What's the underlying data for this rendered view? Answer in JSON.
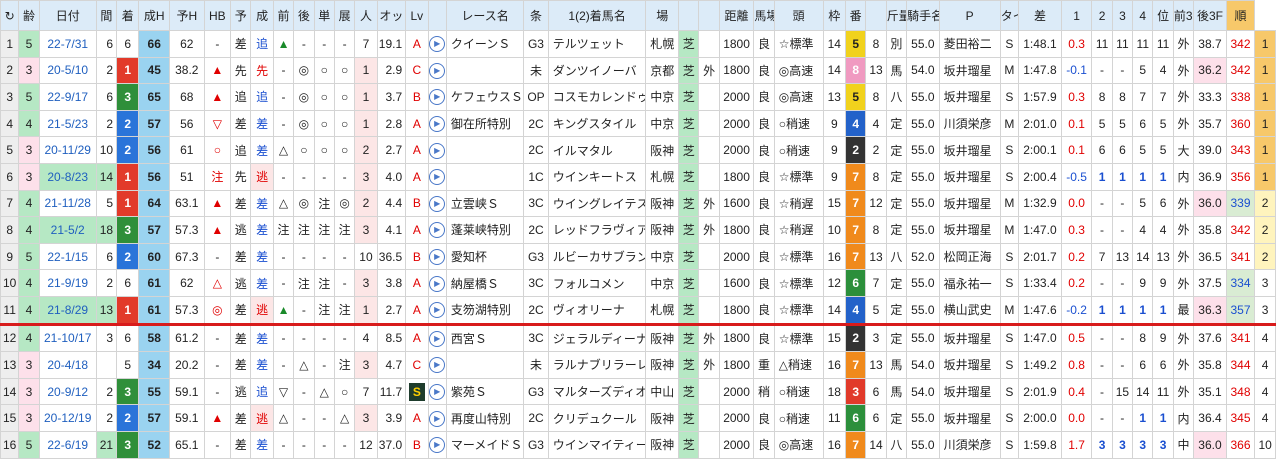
{
  "headers": [
    "↻",
    "齢",
    "日付",
    "間",
    "着",
    "成H",
    "予H",
    "HB",
    "予",
    "成",
    "前",
    "後",
    "単",
    "展",
    "人",
    "オッ",
    "Lv",
    "",
    "レース名",
    "条",
    "1(2)着馬名",
    "場",
    "",
    "",
    "距離",
    "馬場lv",
    "頭",
    "枠",
    "番",
    "",
    "斤量",
    "騎手名",
    "P",
    "タイム",
    "差",
    "1",
    "2",
    "3",
    "4",
    "位",
    "前3F",
    "後3F",
    "順"
  ],
  "rows": [
    [
      "1",
      "5",
      "22-7/31",
      "6",
      "6",
      "66",
      "62",
      "-",
      "差",
      "追",
      "▲",
      "-",
      "-",
      "-",
      "7",
      "19.1",
      "A",
      "▸",
      "クイーンＳ",
      "G3",
      "テルツェット",
      "札幌",
      "芝",
      "",
      "1800",
      "良",
      "☆標準",
      "14",
      "5",
      "8",
      "別",
      "55.0",
      "菱田裕二",
      "S",
      "1:48.1",
      "0.3",
      "11",
      "11",
      "11",
      "11",
      "外",
      "38.7",
      "342",
      "1"
    ],
    [
      "2",
      "3",
      "20-5/10",
      "2",
      "1",
      "45",
      "38.2",
      "▲",
      "先",
      "先",
      "-",
      "◎",
      "○",
      "○",
      "1",
      "2.9",
      "C",
      "▸",
      "",
      "未",
      "ダンツイノーバ",
      "京都",
      "芝",
      "外",
      "1800",
      "良",
      "◎高速",
      "14",
      "8",
      "13",
      "馬",
      "54.0",
      "坂井瑠星",
      "M",
      "1:47.8",
      "-0.1",
      "-",
      "-",
      "5",
      "4",
      "外",
      "36.2",
      "342",
      "1"
    ],
    [
      "3",
      "5",
      "22-9/17",
      "6",
      "3",
      "65",
      "68",
      "▲",
      "追",
      "追",
      "-",
      "◎",
      "○",
      "○",
      "1",
      "3.7",
      "B",
      "▸",
      "ケフェウスＳ",
      "OP",
      "コスモカレンドゥラ",
      "中京",
      "芝",
      "",
      "2000",
      "良",
      "◎高速",
      "13",
      "5",
      "8",
      "八",
      "55.0",
      "坂井瑠星",
      "S",
      "1:57.9",
      "0.3",
      "8",
      "8",
      "7",
      "7",
      "外",
      "33.3",
      "338",
      "1"
    ],
    [
      "4",
      "4",
      "21-5/23",
      "2",
      "2",
      "57",
      "56",
      "▽",
      "差",
      "差",
      "-",
      "◎",
      "○",
      "○",
      "1",
      "2.8",
      "A",
      "▸",
      "御在所特別",
      "2C",
      "キングスタイル",
      "中京",
      "芝",
      "",
      "2000",
      "良",
      "○稍速",
      "9",
      "4",
      "4",
      "定",
      "55.0",
      "川須栄彦",
      "M",
      "2:01.0",
      "0.1",
      "5",
      "5",
      "6",
      "5",
      "外",
      "35.7",
      "360",
      "1"
    ],
    [
      "5",
      "3",
      "20-11/29",
      "10",
      "2",
      "56",
      "61",
      "○",
      "追",
      "差",
      "△",
      "○",
      "○",
      "○",
      "2",
      "2.7",
      "A",
      "▸",
      "",
      "2C",
      "イルマタル",
      "阪神",
      "芝",
      "",
      "2000",
      "良",
      "○稍速",
      "9",
      "2",
      "2",
      "定",
      "55.0",
      "坂井瑠星",
      "S",
      "2:00.1",
      "0.1",
      "6",
      "6",
      "5",
      "5",
      "大",
      "39.0",
      "343",
      "1"
    ],
    [
      "6",
      "3",
      "20-8/23",
      "14",
      "1",
      "56",
      "51",
      "注",
      "先",
      "逃",
      "-",
      "-",
      "-",
      "-",
      "3",
      "4.0",
      "A",
      "▸",
      "",
      "1C",
      "ウインキートス",
      "札幌",
      "芝",
      "",
      "1800",
      "良",
      "☆標準",
      "9",
      "7",
      "8",
      "定",
      "55.0",
      "坂井瑠星",
      "S",
      "2:00.4",
      "-0.5",
      "1",
      "1",
      "1",
      "1",
      "内",
      "36.9",
      "356",
      "1"
    ],
    [
      "7",
      "4",
      "21-11/28",
      "5",
      "1",
      "64",
      "63.1",
      "▲",
      "差",
      "差",
      "△",
      "◎",
      "注",
      "◎",
      "2",
      "4.4",
      "B",
      "▸",
      "立雲峡Ｓ",
      "3C",
      "ウイングレイテスト",
      "阪神",
      "芝",
      "外",
      "1600",
      "良",
      "☆稍遅",
      "15",
      "7",
      "12",
      "定",
      "55.0",
      "坂井瑠星",
      "M",
      "1:32.9",
      "0.0",
      "-",
      "-",
      "5",
      "6",
      "外",
      "36.0",
      "339",
      "2"
    ],
    [
      "8",
      "4",
      "21-5/2",
      "18",
      "3",
      "57",
      "57.3",
      "▲",
      "逃",
      "差",
      "注",
      "注",
      "注",
      "注",
      "3",
      "4.1",
      "A",
      "▸",
      "蓬莱峡特別",
      "2C",
      "レッドフラヴィア",
      "阪神",
      "芝",
      "外",
      "1800",
      "良",
      "☆稍遅",
      "10",
      "7",
      "8",
      "定",
      "55.0",
      "坂井瑠星",
      "M",
      "1:47.0",
      "0.3",
      "-",
      "-",
      "4",
      "4",
      "外",
      "35.8",
      "342",
      "2"
    ],
    [
      "9",
      "5",
      "22-1/15",
      "6",
      "2",
      "60",
      "67.3",
      "-",
      "差",
      "差",
      "-",
      "-",
      "-",
      "-",
      "10",
      "36.5",
      "B",
      "▸",
      "愛知杯",
      "G3",
      "ルビーカサブランカ",
      "中京",
      "芝",
      "",
      "2000",
      "良",
      "☆標準",
      "16",
      "7",
      "13",
      "八",
      "52.0",
      "松岡正海",
      "S",
      "2:01.7",
      "0.2",
      "7",
      "13",
      "14",
      "13",
      "外",
      "36.5",
      "341",
      "2"
    ],
    [
      "10",
      "4",
      "21-9/19",
      "2",
      "6",
      "61",
      "62",
      "△",
      "逃",
      "差",
      "-",
      "注",
      "注",
      "-",
      "3",
      "3.8",
      "A",
      "▸",
      "納屋橋Ｓ",
      "3C",
      "フォルコメン",
      "中京",
      "芝",
      "",
      "1600",
      "良",
      "☆標準",
      "12",
      "6",
      "7",
      "定",
      "55.0",
      "福永祐一",
      "S",
      "1:33.4",
      "0.2",
      "-",
      "-",
      "9",
      "9",
      "外",
      "37.5",
      "334",
      "3"
    ],
    [
      "11",
      "4",
      "21-8/29",
      "13",
      "1",
      "61",
      "57.3",
      "◎",
      "差",
      "逃",
      "▲",
      "-",
      "注",
      "注",
      "1",
      "2.7",
      "A",
      "▸",
      "支笏湖特別",
      "2C",
      "ヴィオリーナ",
      "札幌",
      "芝",
      "",
      "1800",
      "良",
      "☆標準",
      "14",
      "4",
      "5",
      "定",
      "55.0",
      "横山武史",
      "M",
      "1:47.6",
      "-0.2",
      "1",
      "1",
      "1",
      "1",
      "最",
      "36.3",
      "357",
      "3"
    ],
    [
      "12",
      "4",
      "21-10/17",
      "3",
      "6",
      "58",
      "61.2",
      "-",
      "差",
      "差",
      "-",
      "-",
      "-",
      "-",
      "4",
      "8.5",
      "A",
      "▸",
      "西宮Ｓ",
      "3C",
      "ジェラルディーナ",
      "阪神",
      "芝",
      "外",
      "1800",
      "良",
      "☆標準",
      "15",
      "2",
      "3",
      "定",
      "55.0",
      "坂井瑠星",
      "S",
      "1:47.0",
      "0.5",
      "-",
      "-",
      "8",
      "9",
      "外",
      "37.6",
      "341",
      "4"
    ],
    [
      "13",
      "3",
      "20-4/18",
      "",
      "5",
      "34",
      "20.2",
      "-",
      "差",
      "差",
      "-",
      "△",
      "-",
      "注",
      "3",
      "4.7",
      "C",
      "▸",
      "",
      "未",
      "ラルナブリラーレ",
      "阪神",
      "芝",
      "外",
      "1800",
      "重",
      "△稍速",
      "16",
      "7",
      "13",
      "馬",
      "54.0",
      "坂井瑠星",
      "S",
      "1:49.2",
      "0.8",
      "-",
      "-",
      "6",
      "6",
      "外",
      "35.8",
      "344",
      "4"
    ],
    [
      "14",
      "3",
      "20-9/12",
      "2",
      "3",
      "55",
      "59.1",
      "-",
      "逃",
      "追",
      "▽",
      "-",
      "△",
      "○",
      "7",
      "11.7",
      "S",
      "▸",
      "紫苑Ｓ",
      "G3",
      "マルターズディオサ",
      "中山",
      "芝",
      "",
      "2000",
      "稍",
      "○稍速",
      "18",
      "3",
      "6",
      "馬",
      "54.0",
      "坂井瑠星",
      "S",
      "2:01.9",
      "0.4",
      "-",
      "15",
      "14",
      "11",
      "外",
      "35.1",
      "348",
      "4"
    ],
    [
      "15",
      "3",
      "20-12/19",
      "2",
      "2",
      "57",
      "59.1",
      "▲",
      "差",
      "逃",
      "△",
      "-",
      "-",
      "△",
      "3",
      "3.9",
      "A",
      "▸",
      "再度山特別",
      "2C",
      "クリデュクール",
      "阪神",
      "芝",
      "",
      "2000",
      "良",
      "○稍速",
      "11",
      "6",
      "6",
      "定",
      "55.0",
      "坂井瑠星",
      "S",
      "2:00.0",
      "0.0",
      "-",
      "-",
      "1",
      "1",
      "内",
      "36.4",
      "345",
      "4"
    ],
    [
      "16",
      "5",
      "22-6/19",
      "21",
      "3",
      "52",
      "65.1",
      "-",
      "差",
      "差",
      "-",
      "-",
      "-",
      "-",
      "12",
      "37.0",
      "B",
      "▸",
      "マーメイドＳ",
      "G3",
      "ウインマイティー",
      "阪神",
      "芝",
      "",
      "2000",
      "良",
      "◎高速",
      "16",
      "7",
      "14",
      "八",
      "55.0",
      "川須栄彦",
      "S",
      "1:59.8",
      "1.7",
      "3",
      "3",
      "3",
      "3",
      "中",
      "36.0",
      "366",
      "10"
    ]
  ],
  "colors": {
    "header": "#dcebf8",
    "turf": "#b6e8c4",
    "separator": "#d81b1b"
  }
}
